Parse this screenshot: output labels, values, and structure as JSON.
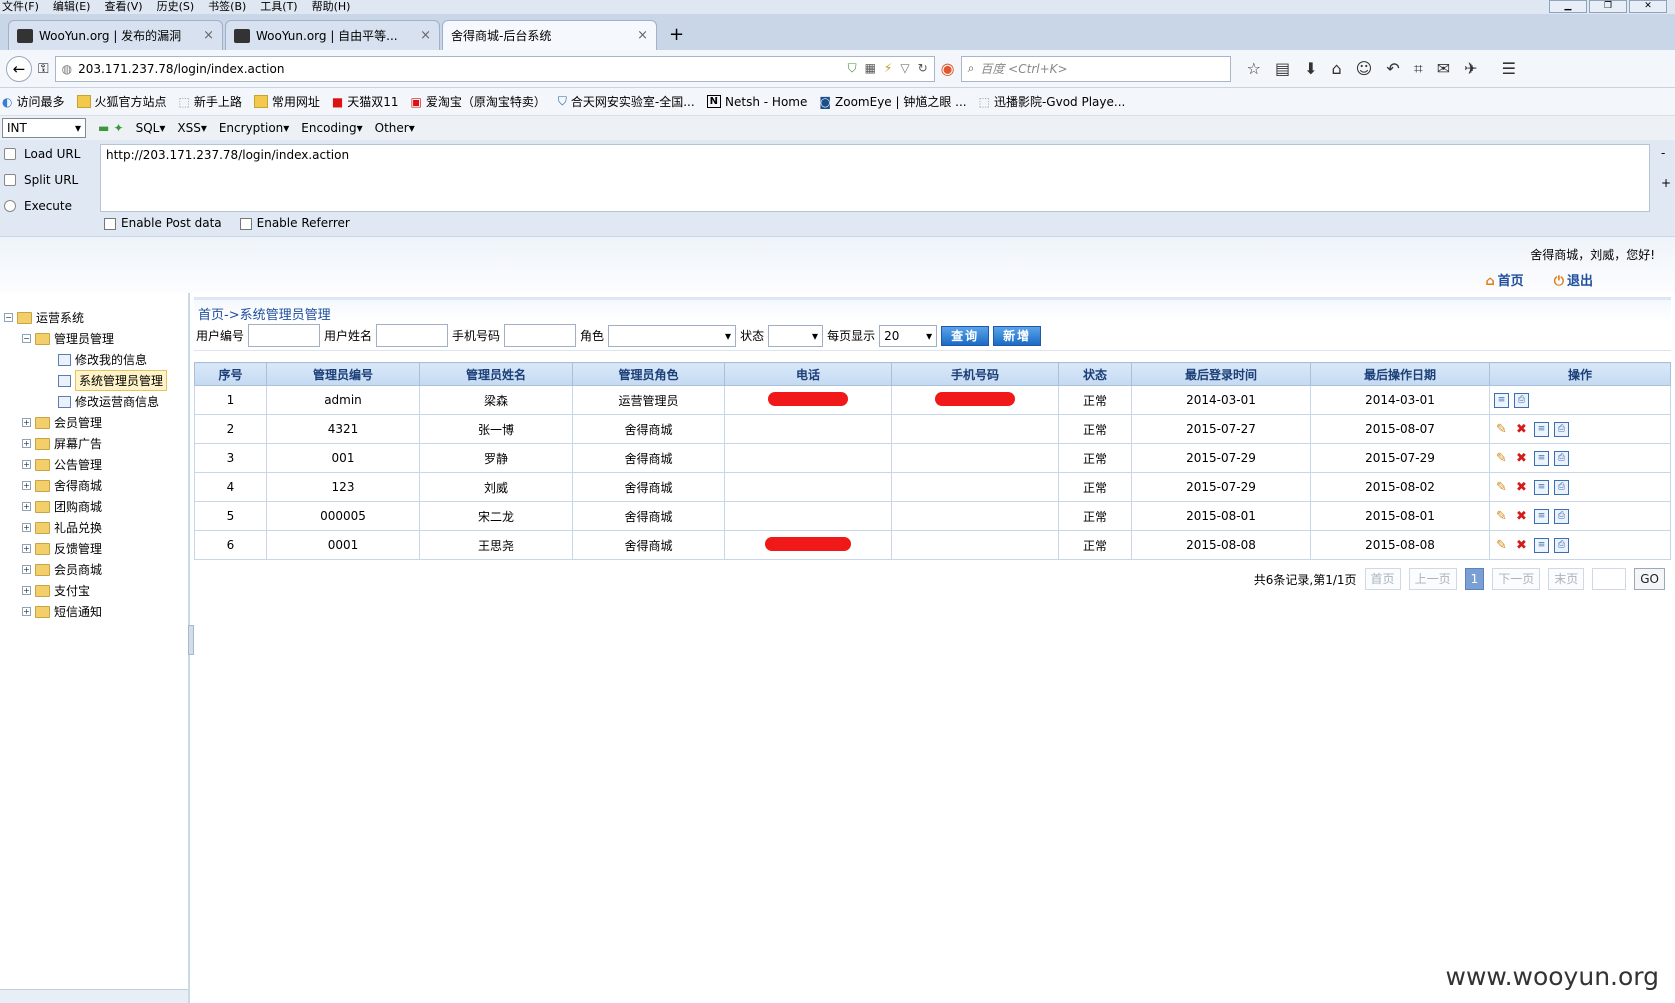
{
  "menubar": {
    "items": [
      "文件(F)",
      "编辑(E)",
      "查看(V)",
      "历史(S)",
      "书签(B)",
      "工具(T)",
      "帮助(H)"
    ]
  },
  "tabs": [
    {
      "label": "WooYun.org | 发布的漏洞"
    },
    {
      "label": "WooYun.org | 自由平等..."
    },
    {
      "label": "舍得商城-后台系统"
    }
  ],
  "new_tab": "+",
  "close_glyph": "×",
  "navbar": {
    "url": "203.171.237.78/login/index.action",
    "search_placeholder": "百度 <Ctrl+K>"
  },
  "bookmarks": [
    "访问最多",
    "火狐官方站点",
    "新手上路",
    "常用网址",
    "天猫双11",
    "爱淘宝（原淘宝特卖）",
    "合天网安实验室-全国...",
    "Netsh - Home",
    "ZoomEye | 钟馗之眼 ...",
    "迅播影院-Gvod Playe..."
  ],
  "hackbar": {
    "select_value": "INT",
    "menus": [
      "SQL▾",
      "XSS▾",
      "Encryption▾",
      "Encoding▾",
      "Other▾"
    ],
    "load_url": "Load URL",
    "split_url": "Split URL",
    "execute": "Execute",
    "url_text": "http://203.171.237.78/login/index.action",
    "enable_post": "Enable Post data",
    "enable_referrer": "Enable Referrer",
    "side_minus": "-",
    "side_plus": "+"
  },
  "app_header": {
    "welcome": "舍得商城，刘威，您好!",
    "home_link": "首页",
    "logout_link": "退出"
  },
  "sidebar": {
    "root": "运营系统",
    "admin_group": "管理员管理",
    "admin_children": [
      "修改我的信息",
      "系统管理员管理",
      "修改运营商信息"
    ],
    "groups": [
      "会员管理",
      "屏幕广告",
      "公告管理",
      "舍得商城",
      "团购商城",
      "礼品兑换",
      "反馈管理",
      "会员商城",
      "支付宝",
      "短信通知"
    ]
  },
  "breadcrumb": "首页->系统管理员管理",
  "filter": {
    "user_id_label": "用户编号",
    "user_name_label": "用户姓名",
    "phone_label": "手机号码",
    "role_label": "角色",
    "status_label": "状态",
    "per_page_label": "每页显示",
    "per_page_value": "20",
    "query_button": "查询",
    "add_button": "新增"
  },
  "table": {
    "columns": [
      "序号",
      "管理员编号",
      "管理员姓名",
      "管理员角色",
      "电话",
      "手机号码",
      "状态",
      "最后登录时间",
      "最后操作日期",
      "操作"
    ],
    "rows": [
      {
        "no": "1",
        "id": "admin",
        "name": "梁森",
        "role": "运营管理员",
        "status": "正常",
        "last_login": "2014-03-01",
        "last_op": "2014-03-01"
      },
      {
        "no": "2",
        "id": "4321",
        "name": "张一博",
        "role": "舍得商城",
        "status": "正常",
        "last_login": "2015-07-27",
        "last_op": "2015-08-07"
      },
      {
        "no": "3",
        "id": "001",
        "name": "罗静",
        "role": "舍得商城",
        "status": "正常",
        "last_login": "2015-07-29",
        "last_op": "2015-07-29"
      },
      {
        "no": "4",
        "id": "123",
        "name": "刘威",
        "role": "舍得商城",
        "status": "正常",
        "last_login": "2015-07-29",
        "last_op": "2015-08-02"
      },
      {
        "no": "5",
        "id": "000005",
        "name": "宋二龙",
        "role": "舍得商城",
        "status": "正常",
        "last_login": "2015-08-01",
        "last_op": "2015-08-01"
      },
      {
        "no": "6",
        "id": "0001",
        "name": "王思尧",
        "role": "舍得商城",
        "status": "正常",
        "last_login": "2015-08-08",
        "last_op": "2015-08-08"
      }
    ]
  },
  "pager": {
    "summary": "共6条记录,第1/1页",
    "first": "首页",
    "prev": "上一页",
    "current": "1",
    "next": "下一页",
    "last": "末页",
    "go": "GO"
  },
  "watermark": "www.wooyun.org"
}
